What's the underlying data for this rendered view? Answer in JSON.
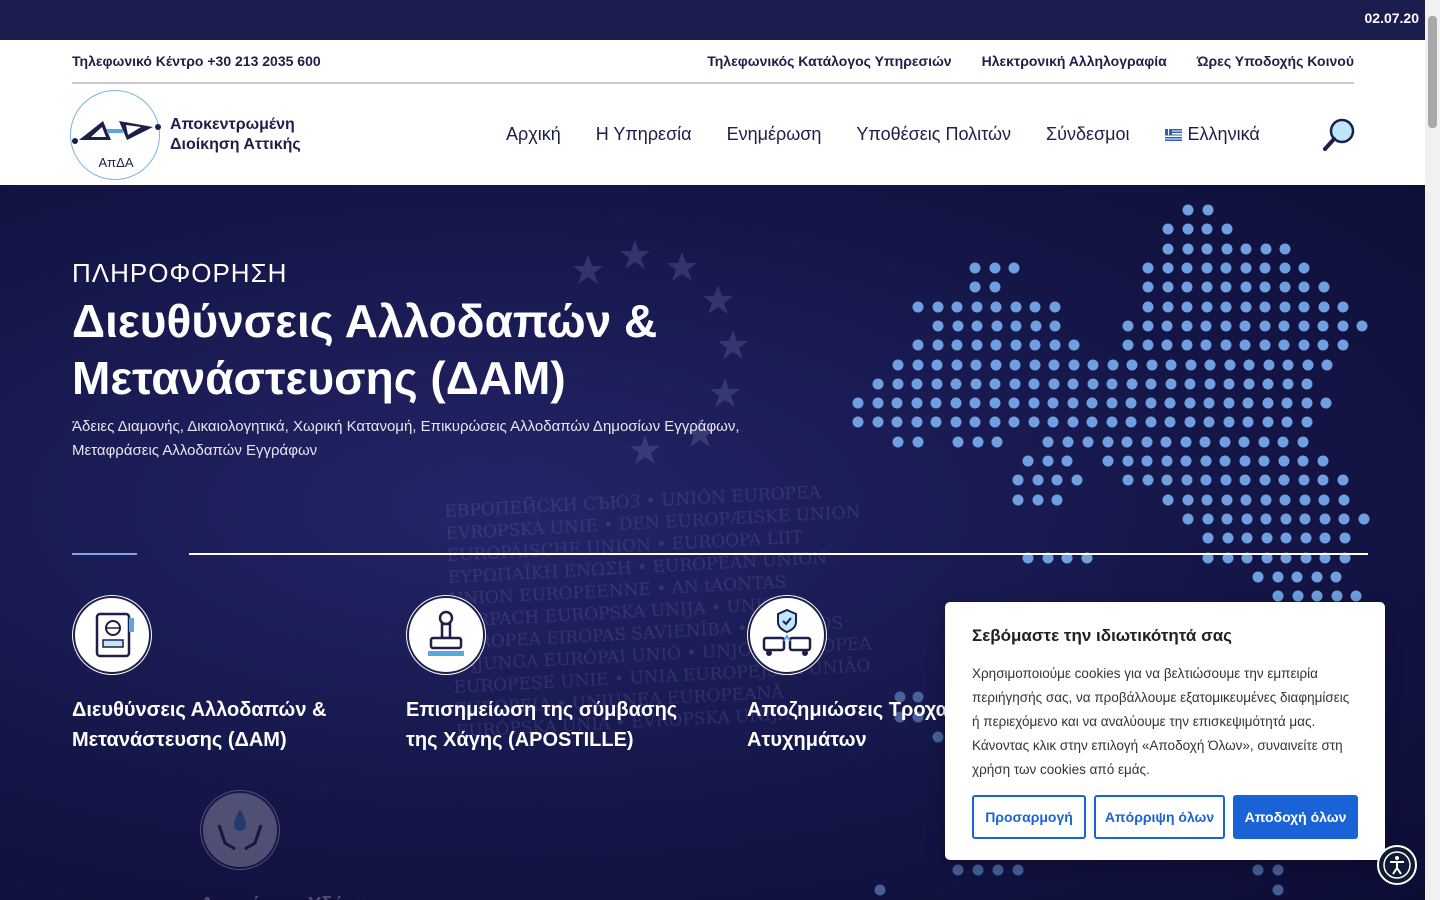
{
  "topbar": {
    "date": "02.07.20"
  },
  "header": {
    "phone": "Τηλεφωνικό Κέντρο +30 213 2035 600",
    "util_links": [
      "Τηλεφωνικός Κατάλογος Υπηρεσιών",
      "Ηλεκτρονική Αλληλογραφία",
      "Ώρες Υποδοχής Κοινού"
    ],
    "logo": {
      "mark": "ΑπΔΑ",
      "line1": "Αποκεντρωμένη",
      "line2": "Διοίκηση Αττικής"
    },
    "nav": [
      "Αρχική",
      "Η Υπηρεσία",
      "Ενημέρωση",
      "Υποθέσεις Πολιτών",
      "Σύνδεσμοι"
    ],
    "language": "Ελληνικά"
  },
  "hero": {
    "eyebrow": "ΠΛΗΡΟΦΟΡΗΣΗ",
    "title": "Διευθύνσεις Αλλοδαπών & Μετανάστευσης (ΔΑΜ)",
    "subtitle": "Άδειες Διαμονής, Δικαιολογητικά, Χωρική Κατανομή, Επικυρώσεις Αλλοδαπών Δημοσίων Εγγράφων, Μεταφράσεις Αλλοδαπών Εγγράφων",
    "background_text": "ЕВРОПЕЙСКИ СЪЮЗ • UNIÓN EUROPEA EVROPSKÁ UNIE • DEN EUROPÆISKE UNION EUROPÄISCHE UNION • EUROOPA LIIT ΕΥΡΩΠΑΪΚΗ ΕΝΩΣΗ • EUROPEAN UNION UNION EUROPÉENNE • AN tAONTAS EORPACH EUROPSKA UNIJA • UNIONE EUROPEA EIROPAS SAVIENĪBA • EUROPOS SĄJUNGA EURÓPAI UNIÓ • UNJONI EWROPEA EUROPESE UNIE • UNIA EUROPEJSKA UNIÃO EUROPEIA • UNIUNEA EUROPEANĂ EURÓPSKA ÚNIA • EVROPSKA UNIJA"
  },
  "services": [
    {
      "label": "Διευθύνσεις Αλλοδαπών & Μετανάστευσης (ΔΑΜ)",
      "icon": "passport-icon"
    },
    {
      "label": "Επισημείωση της σύμβασης της Χάγης (APOSTILLE)",
      "icon": "stamp-icon"
    },
    {
      "label": "Αποζημιώσεις Τροχαί Ατυχημάτων",
      "icon": "car-accident-icon"
    },
    {
      "label": "Διαχείριση Υδάτων",
      "icon": "water-hands-icon"
    }
  ],
  "cookie": {
    "title": "Σεβόμαστε την ιδιωτικότητά σας",
    "text": "Χρησιμοποιούμε cookies για να βελτιώσουμε την εμπειρία περιήγησής σας, να προβάλλουμε εξατομικευμένες διαφημίσεις ή περιεχόμενο και να αναλύουμε την επισκεψιμότητά μας. Κάνοντας κλικ στην επιλογή «Αποδοχή Όλων», συναινείτε στη χρήση των cookies από εμάς.",
    "customize": "Προσαρμογή",
    "reject": "Απόρριψη όλων",
    "accept": "Αποδοχή όλων"
  },
  "colors": {
    "navy": "#1d1f4a",
    "hero_bg": "#151648",
    "dot_blue": "#6f9fe0",
    "cookie_button": "#1a63d6"
  }
}
